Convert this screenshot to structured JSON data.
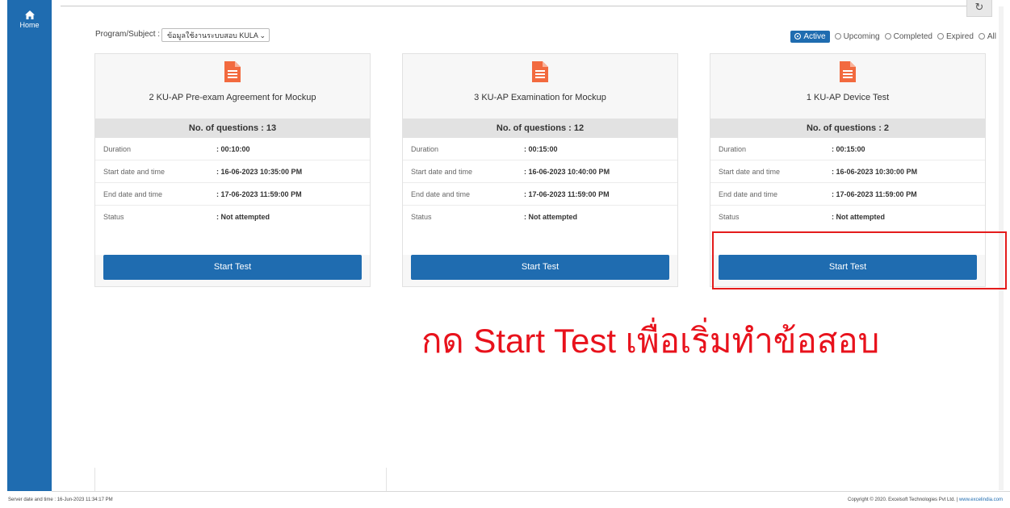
{
  "sidebar": {
    "home_label": "Home"
  },
  "toolbar": {
    "refresh_glyph": "↻"
  },
  "program": {
    "label": "Program/Subject :",
    "selected": "ข้อมูลใช้งานระบบสอบ KULA",
    "chevron": "⌄"
  },
  "filters": [
    {
      "label": "Active",
      "selected": true
    },
    {
      "label": "Upcoming",
      "selected": false
    },
    {
      "label": "Completed",
      "selected": false
    },
    {
      "label": "Expired",
      "selected": false
    },
    {
      "label": "All",
      "selected": false
    }
  ],
  "cards": [
    {
      "title": "2 KU-AP Pre-exam Agreement for Mockup",
      "questions": "No. of questions : 13",
      "rows": [
        {
          "label": "Duration",
          "value": ": 00:10:00"
        },
        {
          "label": "Start date and time",
          "value": ": 16-06-2023 10:35:00 PM"
        },
        {
          "label": "End date and time",
          "value": ": 17-06-2023 11:59:00 PM"
        },
        {
          "label": "Status",
          "value": ": Not attempted"
        }
      ],
      "button": "Start Test"
    },
    {
      "title": "3 KU-AP Examination for Mockup",
      "questions": "No. of questions : 12",
      "rows": [
        {
          "label": "Duration",
          "value": ": 00:15:00"
        },
        {
          "label": "Start date and time",
          "value": ": 16-06-2023 10:40:00 PM"
        },
        {
          "label": "End date and time",
          "value": ": 17-06-2023 11:59:00 PM"
        },
        {
          "label": "Status",
          "value": ": Not attempted"
        }
      ],
      "button": "Start Test"
    },
    {
      "title": "1 KU-AP Device Test",
      "questions": "No. of questions : 2",
      "rows": [
        {
          "label": "Duration",
          "value": ": 00:15:00"
        },
        {
          "label": "Start date and time",
          "value": ": 16-06-2023 10:30:00 PM"
        },
        {
          "label": "End date and time",
          "value": ": 17-06-2023 11:59:00 PM"
        },
        {
          "label": "Status",
          "value": ": Not attempted"
        }
      ],
      "button": "Start Test"
    }
  ],
  "annotation": {
    "text": "กด Start Test เพื่อเริ่มทำข้อสอบ",
    "color": "#e8121c"
  },
  "footer": {
    "server_time": "Server date and time : 16-Jun-2023 11:34:17 PM",
    "copyright": "Copyright © 2020. Excelsoft Technologies Pvt Ltd. | ",
    "link": "www.excelindia.com"
  },
  "colors": {
    "primary": "#1f6cb0",
    "doc_icon": "#f26a3f",
    "highlight": "#e41b1b"
  }
}
